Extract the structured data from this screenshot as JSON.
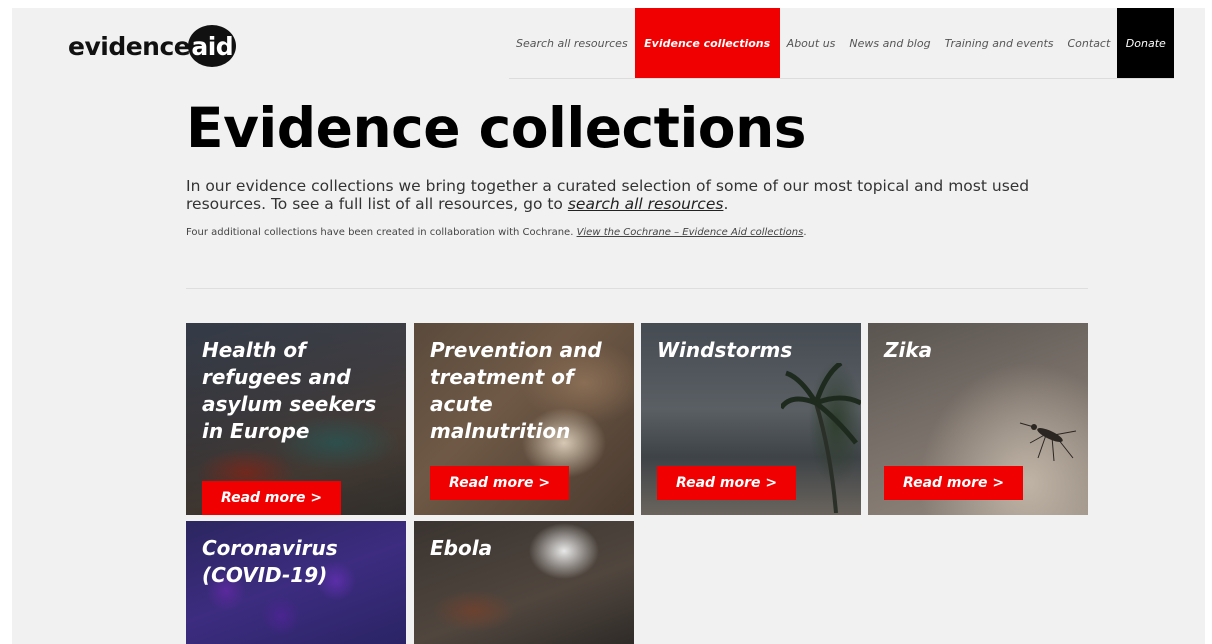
{
  "header": {
    "logo": {
      "word": "evidence",
      "circle": "aid"
    },
    "nav": [
      {
        "label": "Search all resources",
        "active": false
      },
      {
        "label": "Evidence collections",
        "active": true
      },
      {
        "label": "About us",
        "active": false
      },
      {
        "label": "News and blog",
        "active": false
      },
      {
        "label": "Training and events",
        "active": false
      },
      {
        "label": "Contact",
        "active": false
      },
      {
        "label": "Donate",
        "active": false
      }
    ]
  },
  "main": {
    "title": "Evidence collections",
    "intro_text": "In our evidence collections we bring together a curated selection of some of our most topical and most used resources. To see a full list of all resources, go to ",
    "intro_link": "search all resources",
    "intro_end": ".",
    "note_text": "Four additional collections have been created in collaboration with Cochrane. ",
    "note_link": "View the Cochrane – Evidence Aid collections",
    "note_end": "."
  },
  "collections": [
    {
      "title": "Health of refugees and asylum seekers in Europe",
      "read_more": "Read more >"
    },
    {
      "title": "Prevention and treatment of acute malnutrition",
      "read_more": "Read more >"
    },
    {
      "title": "Windstorms",
      "read_more": "Read more >"
    },
    {
      "title": "Zika",
      "read_more": "Read more >"
    },
    {
      "title": "Coronavirus (COVID-19)"
    },
    {
      "title": "Ebola"
    }
  ],
  "colors": {
    "accent": "#f00000",
    "background": "#f1f1f1",
    "donate": "#000000"
  }
}
